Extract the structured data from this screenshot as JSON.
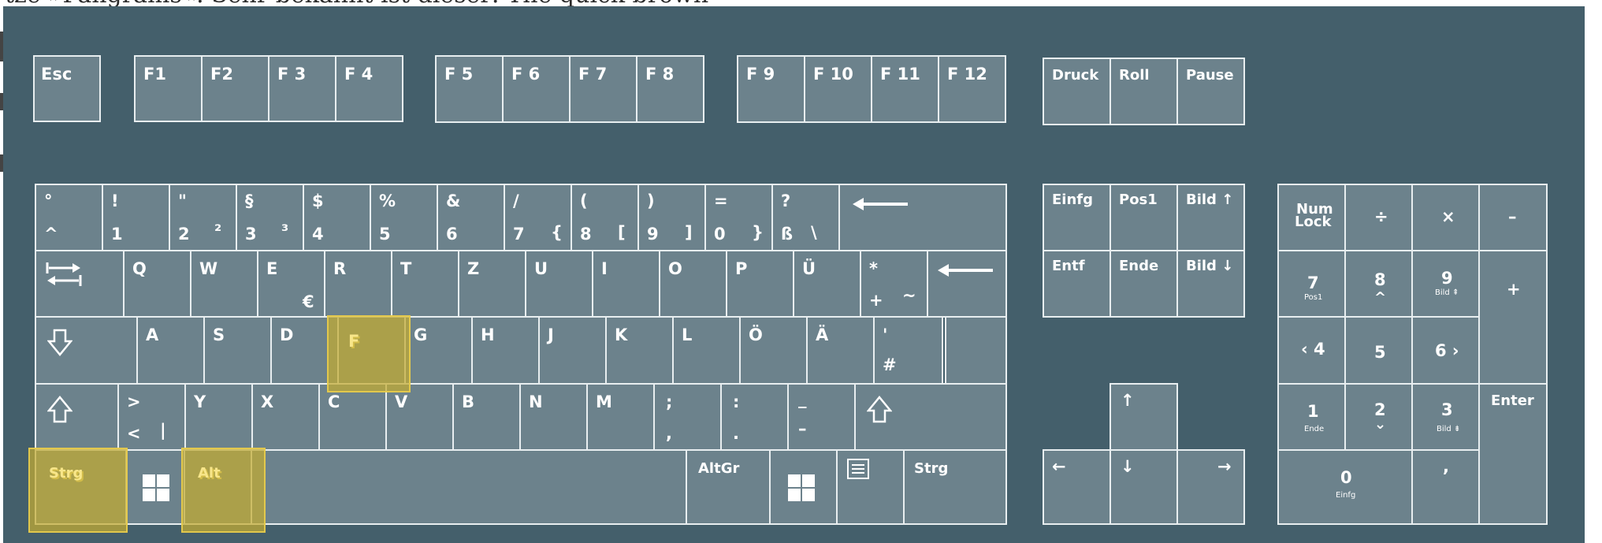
{
  "background_text": "tze »Pangrams«. Sehr bekannt ist dieser: The quick brown",
  "colors": {
    "board": "#445f6b",
    "key": "#6c828c",
    "key_border": "#e8eef0",
    "highlight": "#c4ac30",
    "highlight_text": "#f8e68a"
  },
  "function_row": {
    "esc": "Esc",
    "group1": [
      "F1",
      "F2",
      "F 3",
      "F 4"
    ],
    "group2": [
      "F 5",
      "F 6",
      "F 7",
      "F 8"
    ],
    "group3": [
      "F 9",
      "F 10",
      "F 11",
      "F 12"
    ],
    "system": [
      "Druck",
      "Roll",
      "Pause"
    ]
  },
  "number_row": [
    {
      "top": "°",
      "bottom": "^"
    },
    {
      "top": "!",
      "bottom": "1"
    },
    {
      "top": "\"",
      "bottom": "2",
      "alt": "²"
    },
    {
      "top": "§",
      "bottom": "3",
      "alt": "³"
    },
    {
      "top": "$",
      "bottom": "4"
    },
    {
      "top": "%",
      "bottom": "5"
    },
    {
      "top": "&",
      "bottom": "6"
    },
    {
      "top": "/",
      "bottom": "7",
      "alt": "{"
    },
    {
      "top": "(",
      "bottom": "8",
      "alt": "["
    },
    {
      "top": ")",
      "bottom": "9",
      "alt": "]"
    },
    {
      "top": "=",
      "bottom": "0",
      "alt": "}"
    },
    {
      "top": "?",
      "bottom": "ß",
      "alt": "\\"
    }
  ],
  "backspace_icon": "left-arrow-icon",
  "qwertz_row": [
    "Q",
    "W",
    "E",
    "R",
    "T",
    "Z",
    "U",
    "I",
    "O",
    "P",
    "Ü"
  ],
  "e_alt": "€",
  "plus_key": {
    "top": "*",
    "bottom": "+",
    "alt": "~"
  },
  "asdf_row": [
    "A",
    "S",
    "D",
    "F",
    "G",
    "H",
    "J",
    "K",
    "L",
    "Ö",
    "Ä"
  ],
  "hash_key": {
    "top": "'",
    "bottom": "#"
  },
  "angle_key": {
    "top": ">",
    "bottom": "<",
    "alt": "|"
  },
  "yxcv_row": [
    "Y",
    "X",
    "C",
    "V",
    "B",
    "N",
    "M"
  ],
  "punct_keys": [
    {
      "top": ";",
      "bottom": ","
    },
    {
      "top": ":",
      "bottom": "."
    },
    {
      "top": "_",
      "bottom": "–"
    }
  ],
  "bottom_row": {
    "strg_left": "Strg",
    "alt": "Alt",
    "altgr": "AltGr",
    "strg_right": "Strg"
  },
  "nav_cluster": [
    "Einfg",
    "Pos1",
    "Bild ↑",
    "Entf",
    "Ende",
    "Bild ↓"
  ],
  "arrows": {
    "up": "↑",
    "left": "←",
    "down": "↓",
    "right": "→"
  },
  "numpad": {
    "numlock_1": "Num",
    "numlock_2": "Lock",
    "divide": "÷",
    "multiply": "×",
    "minus": "–",
    "plus": "+",
    "enter": "Enter",
    "k7": "7",
    "k7_sub": "Pos1",
    "k8": "8",
    "k8_sub": "^",
    "k9": "9",
    "k9_sub": "Bild ⇞",
    "k4": "‹ 4",
    "k5": "5",
    "k6": "6 ›",
    "k1": "1",
    "k1_sub": "Ende",
    "k2": "2",
    "k2_sub": "⌄",
    "k3": "3",
    "k3_sub": "Bild ⇟",
    "k0": "0",
    "k0_sub": "Einfg",
    "comma": ","
  },
  "highlighted_keys": [
    "Strg",
    "Alt",
    "F"
  ]
}
